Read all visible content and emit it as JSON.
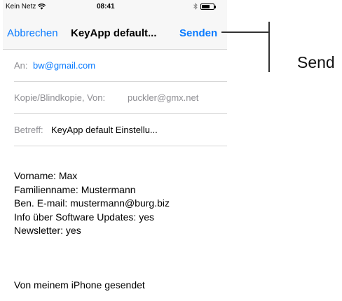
{
  "status_bar": {
    "carrier": "Kein Netz",
    "time": "08:41",
    "battery_level": 0.7,
    "icons": [
      "wifi-icon",
      "bluetooth-icon",
      "battery-icon"
    ]
  },
  "nav": {
    "cancel_label": "Abbrechen",
    "title": "KeyApp default...",
    "send_label": "Senden"
  },
  "fields": {
    "to_label": "An:",
    "to_value": "bw@gmail.com",
    "cc_label": "Kopie/Blindkopie, Von:",
    "cc_value": "puckler@gmx.net",
    "subject_label": "Betreff:",
    "subject_value": "KeyApp default Einstellu..."
  },
  "body": {
    "lines": [
      "Vorname: Max",
      "Familienname: Mustermann",
      "Ben. E-mail: mustermann@burg.biz",
      "Info über Software Updates: yes",
      "Newsletter: yes"
    ],
    "signature": "Von meinem iPhone gesendet"
  },
  "annotation": {
    "label": "Send"
  },
  "colors": {
    "accent": "#0a7bff",
    "secondary_text": "#8e8e93",
    "bar_background": "#f7f7f7"
  }
}
